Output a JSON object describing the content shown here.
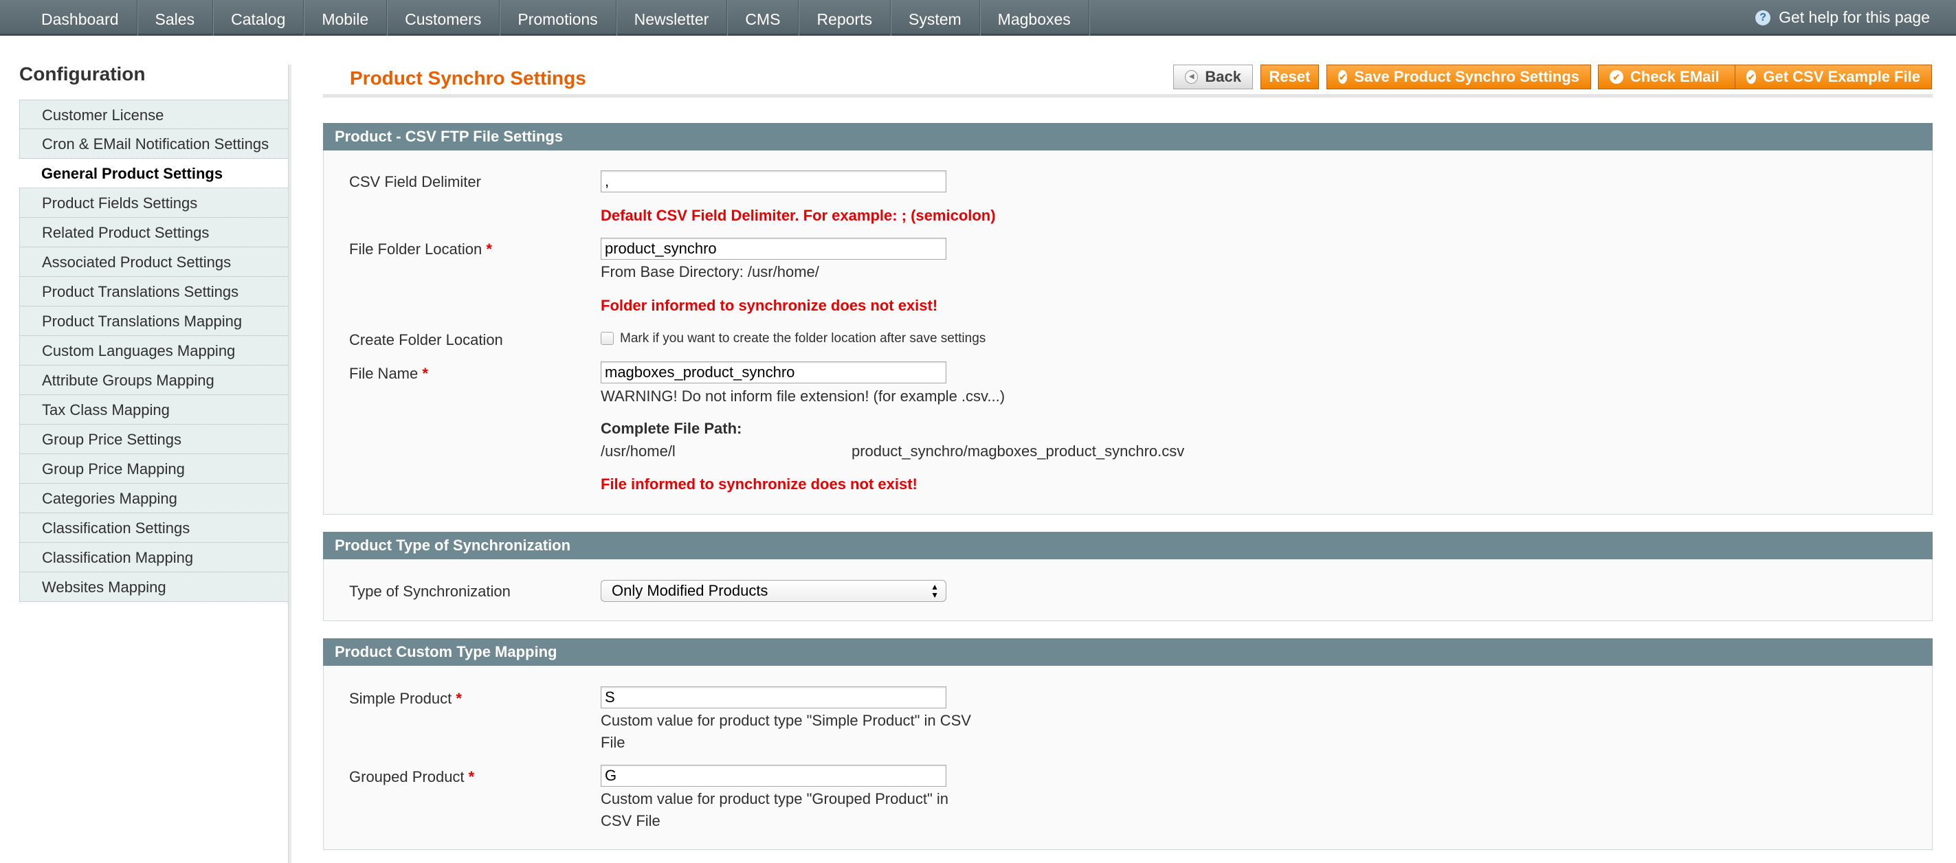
{
  "nav": {
    "items": [
      "Dashboard",
      "Sales",
      "Catalog",
      "Mobile",
      "Customers",
      "Promotions",
      "Newsletter",
      "CMS",
      "Reports",
      "System",
      "Magboxes"
    ],
    "help": "Get help for this page"
  },
  "sidebar": {
    "title": "Configuration",
    "items": [
      "Customer License",
      "Cron & EMail Notification Settings",
      "General Product Settings",
      "Product Fields Settings",
      "Related Product Settings",
      "Associated Product Settings",
      "Product Translations Settings",
      "Product Translations Mapping",
      "Custom Languages Mapping",
      "Attribute Groups Mapping",
      "Tax Class Mapping",
      "Group Price Settings",
      "Group Price Mapping",
      "Categories Mapping",
      "Classification Settings",
      "Classification Mapping",
      "Websites Mapping"
    ],
    "active_index": 2
  },
  "header": {
    "title": "Product Synchro Settings",
    "buttons": {
      "back": "Back",
      "reset": "Reset",
      "save": "Save Product Synchro Settings",
      "check_email": "Check EMail",
      "csv_example": "Get CSV Example File"
    }
  },
  "csv_section": {
    "title": "Product - CSV FTP File Settings",
    "delimiter_label": "CSV Field Delimiter",
    "delimiter_value": ",",
    "delimiter_hint": "Default CSV Field Delimiter. For example: ; (semicolon)",
    "folder_label": "File Folder Location",
    "folder_value": "product_synchro",
    "folder_note": "From Base Directory: /usr/home/",
    "folder_error": "Folder informed to synchronize does not exist!",
    "create_folder_label": "Create Folder Location",
    "create_folder_checkbox": "Mark if you want to create the folder location after save settings",
    "file_name_label": "File Name",
    "file_name_value": "magboxes_product_synchro",
    "file_name_warning": "WARNING! Do not inform file extension! (for example .csv...)",
    "path_label": "Complete File Path:",
    "path_base": "/usr/home/l",
    "path_rest": "product_synchro/magboxes_product_synchro.csv",
    "file_error": "File informed to synchronize does not exist!"
  },
  "sync_section": {
    "title": "Product Type of Synchronization",
    "type_label": "Type of Synchronization",
    "type_value": "Only Modified Products"
  },
  "mapping_section": {
    "title": "Product Custom Type Mapping",
    "simple_label": "Simple Product",
    "simple_value": "S",
    "simple_note_1": "Custom value for product type \"Simple Product\" in CSV",
    "simple_note_2": "File",
    "grouped_label": "Grouped Product",
    "grouped_value": "G",
    "grouped_note_1": "Custom value for product type \"Grouped Product\" in",
    "grouped_note_2": "CSV File"
  },
  "required_mark": "*"
}
